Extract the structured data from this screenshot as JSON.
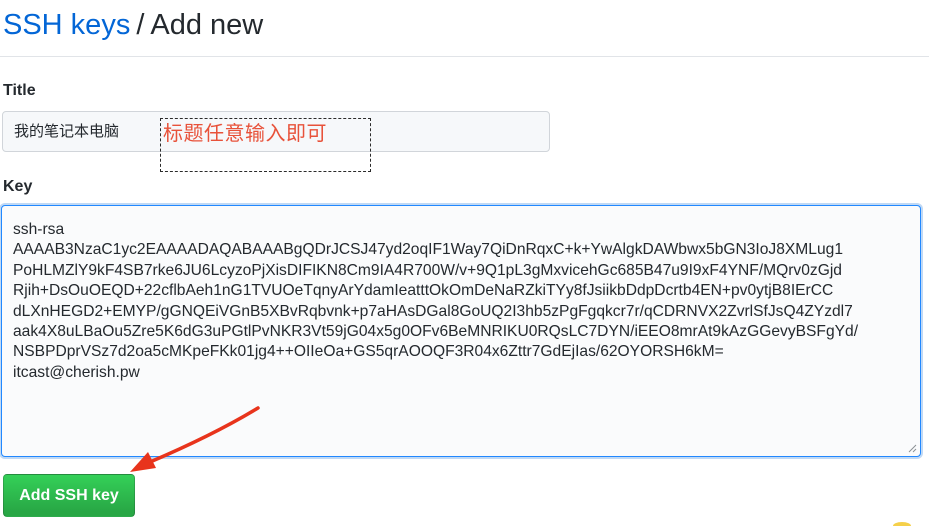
{
  "header": {
    "breadcrumb_link": "SSH keys",
    "separator": "/",
    "current": "Add new"
  },
  "form": {
    "title_label": "Title",
    "title_value": "我的笔记本电脑",
    "key_label": "Key",
    "key_lines": [
      "ssh-rsa",
      "AAAAB3NzaC1yc2EAAAADAQABAAABgQDrJCSJ47yd2oqIF1Way7QiDnRqxC+k+YwAlgkDAWbwx5bGN3IoJ8XMLug1",
      "PoHLMZlY9kF4SB7rke6JU6LcyzoPjXisDIFIKN8Cm9IA4R700W/v+9Q1pL3gMxvicehGc685B47u9I9xF4YNF/MQrv0zGjd",
      "Rjih+DsOuOEQD+22cflbAeh1nG1TVUOeTqnyArYdamIeatttOkOmDeNaRZkiTYy8fJsiikbDdpDcrtb4EN+pv0ytjB8IErCC",
      "dLXnHEGD2+EMYP/gGNQEiVGnB5XBvRqbvnk+p7aHAsDGal8GoUQ2I3hb5zPgFgqkcr7r/qCDRNVX2ZvrlSfJsQ4ZYzdl7",
      "aak4X8uLBaOu5Zre5K6dG3uPGtlPvNKR3Vt59jG04x5g0OFv6BeMNRIKU0RQsLC7DYN/iEEO8mrAt9kAzGGevyBSFgYd/",
      "NSBPDprVSz7d2oa5cMKpeFKk01jg4++OIIeOa+GS5qrAOOQF3R04x6Zttr7GdEjIas/62OYORSH6kM=",
      "itcast@cherish.pw"
    ],
    "submit_label": "Add SSH key"
  },
  "annotation": {
    "text": "标题任意输入即可",
    "color": "#e8523a"
  },
  "colors": {
    "link": "#0366d6",
    "button_green": "#28a745",
    "focus_border": "#2188ff",
    "arrow_red": "#e8341c"
  }
}
